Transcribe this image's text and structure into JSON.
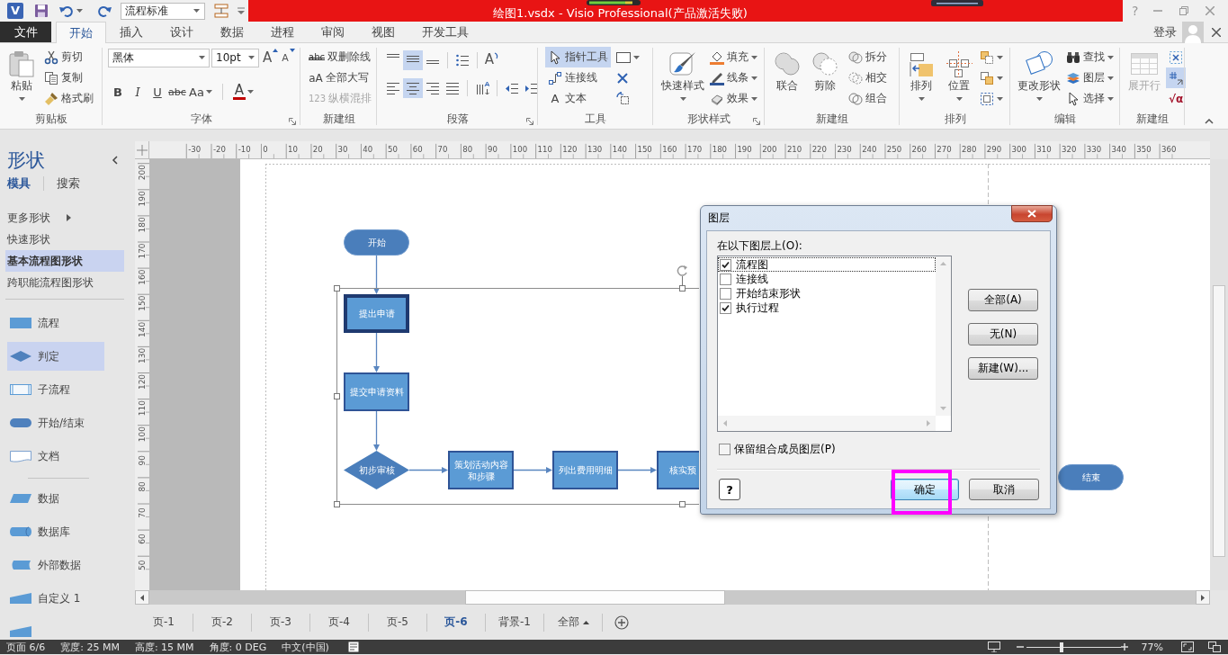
{
  "title_bar": {
    "logo": "V",
    "template": "流程标准",
    "title": "绘图1.vsdx - Visio Professional(产品激活失败)",
    "help": "?"
  },
  "tabs": [
    {
      "label": "文件",
      "kind": "backstage",
      "selected": false
    },
    {
      "label": "开始",
      "kind": "tab",
      "selected": true
    },
    {
      "label": "插入",
      "kind": "tab",
      "selected": false
    },
    {
      "label": "设计",
      "kind": "tab",
      "selected": false
    },
    {
      "label": "数据",
      "kind": "tab",
      "selected": false
    },
    {
      "label": "进程",
      "kind": "tab",
      "selected": false
    },
    {
      "label": "审阅",
      "kind": "tab",
      "selected": false
    },
    {
      "label": "视图",
      "kind": "tab",
      "selected": false
    },
    {
      "label": "开发工具",
      "kind": "tab",
      "selected": false
    }
  ],
  "account": {
    "sign_in": "登录"
  },
  "ribbon": {
    "clipboard": {
      "label": "剪贴板",
      "paste": "粘贴",
      "cut": "剪切",
      "copy": "复制",
      "format_painter": "格式刷"
    },
    "font": {
      "label": "字体",
      "launcher": true,
      "font_name": "黑体",
      "font_size": "10pt",
      "grow": "A",
      "shrink": "A",
      "styles": [
        {
          "glyph": "B",
          "kind": "bold"
        },
        {
          "glyph": "I",
          "kind": "italic"
        },
        {
          "glyph": "U",
          "kind": "underline"
        },
        {
          "glyph": "abc",
          "kind": "strikethrough"
        },
        {
          "glyph": "Aa",
          "kind": "case"
        }
      ],
      "font_color": {
        "glyph": "A",
        "color": "#c00000"
      }
    },
    "text": {
      "label": "新建组",
      "items": [
        {
          "glyph": "abc",
          "label": "双删除线",
          "kind": "double-strike",
          "disabled": false
        },
        {
          "glyph": "aA",
          "label": "全部大写",
          "kind": "caps",
          "disabled": false
        },
        {
          "glyph": "123",
          "label": "纵横混排",
          "kind": "horizontal-in-vertical",
          "disabled": true
        }
      ]
    },
    "paragraph": {
      "label": "段落",
      "launcher": true,
      "vertical_align": [
        {
          "selected": false
        },
        {
          "selected": true
        },
        {
          "selected": false
        }
      ],
      "horizontal_align": [
        {
          "selected": false
        },
        {
          "selected": true
        },
        {
          "selected": false
        },
        {
          "selected": false
        }
      ],
      "rotate_glyph": "A"
    },
    "tools": {
      "label": "工具",
      "items": [
        {
          "label": "指针工具",
          "kind": "pointer",
          "selected": true
        },
        {
          "label": "连接线",
          "kind": "connector",
          "selected": false
        },
        {
          "label": "文本",
          "kind": "text",
          "glyph": "A",
          "selected": false
        }
      ]
    },
    "shape_styles": {
      "label": "形状样式",
      "launcher": true,
      "quick_styles": "快速样式",
      "items": [
        {
          "label": "填充",
          "kind": "fill"
        },
        {
          "label": "线条",
          "kind": "line"
        },
        {
          "label": "效果",
          "kind": "effects"
        }
      ]
    },
    "operations": {
      "label": "新建组",
      "large": [
        {
          "label": "联合",
          "kind": "union"
        },
        {
          "label": "剪除",
          "kind": "subtract"
        }
      ],
      "small": [
        {
          "label": "拆分",
          "kind": "fragment"
        },
        {
          "label": "相交",
          "kind": "intersect"
        },
        {
          "label": "组合",
          "kind": "combine"
        }
      ]
    },
    "arrange": {
      "label": "排列",
      "large": [
        {
          "label": "排列",
          "kind": "arrange"
        },
        {
          "label": "位置",
          "kind": "position"
        }
      ]
    },
    "editing": {
      "label": "编辑",
      "change_shape": "更改形状",
      "items": [
        {
          "label": "查找",
          "kind": "find"
        },
        {
          "label": "图层",
          "kind": "layers"
        },
        {
          "label": "选择",
          "kind": "select"
        }
      ]
    },
    "custom": {
      "label": "新建组",
      "expand": {
        "label": "展开行",
        "disabled": true
      },
      "small": [
        {
          "kind": "snap",
          "selected": false
        },
        {
          "kind": "glue",
          "selected": true
        },
        {
          "kind": "equation",
          "glyph": "√α",
          "selected": false
        }
      ]
    }
  },
  "shapes_panel": {
    "title": "形状",
    "tabs": [
      {
        "label": "模具",
        "selected": true
      },
      {
        "label": "搜索",
        "selected": false
      }
    ],
    "stencils": [
      {
        "label": "更多形状",
        "kind": "submenu",
        "selected": false
      },
      {
        "label": "快速形状",
        "kind": "item",
        "selected": false
      },
      {
        "label": "基本流程图形状",
        "kind": "item",
        "selected": true
      },
      {
        "label": "跨职能流程图形状",
        "kind": "item",
        "selected": false
      }
    ],
    "sections": [
      {
        "masters": [
          {
            "label": "流程",
            "kind": "process",
            "selected": false
          },
          {
            "label": "判定",
            "kind": "decision",
            "selected": true
          },
          {
            "label": "子流程",
            "kind": "subprocess",
            "selected": false
          },
          {
            "label": "开始/结束",
            "kind": "terminator",
            "selected": false
          },
          {
            "label": "文档",
            "kind": "document",
            "selected": false
          }
        ]
      },
      {
        "masters": [
          {
            "label": "数据",
            "kind": "data",
            "selected": false
          },
          {
            "label": "数据库",
            "kind": "database",
            "selected": false
          },
          {
            "label": "外部数据",
            "kind": "external-data",
            "selected": false
          },
          {
            "label": "自定义 1",
            "kind": "custom",
            "selected": false
          },
          {
            "kind": "custom",
            "selected": false
          }
        ]
      }
    ]
  },
  "ruler": {
    "horizontal": [
      "-30",
      "-20",
      "-10",
      "0",
      "10",
      "20",
      "30",
      "40",
      "50",
      "60",
      "70",
      "80",
      "90",
      "100",
      "110",
      "120",
      "130",
      "140",
      "150",
      "160",
      "170",
      "180",
      "190",
      "200",
      "210",
      "220",
      "230",
      "240",
      "250",
      "260",
      "270",
      "280",
      "290",
      "300",
      "310",
      "320",
      "330",
      "340",
      "350",
      "360"
    ],
    "vertical": [
      "200",
      "190",
      "180",
      "170",
      "160",
      "150",
      "140",
      "130",
      "120",
      "110",
      "100",
      "90",
      "80",
      "70",
      "60",
      "50"
    ]
  },
  "diagram": {
    "nodes": [
      {
        "kind": "terminator",
        "label": "开始",
        "selected": false
      },
      {
        "kind": "process",
        "label": "提出申请",
        "selected": true
      },
      {
        "kind": "process",
        "label": "提交申请资料",
        "selected": false
      },
      {
        "kind": "decision",
        "label": "初步审核",
        "selected": false
      },
      {
        "kind": "process",
        "label": "策划活动内容和步骤",
        "selected": false
      },
      {
        "kind": "process",
        "label": "列出费用明细",
        "selected": false
      },
      {
        "kind": "process",
        "label": "核实预",
        "selected": false
      },
      {
        "kind": "terminator",
        "label": "结束",
        "selected": false
      }
    ]
  },
  "dialog": {
    "title": "图层",
    "prompt": "在以下图层上(O):",
    "layers": [
      {
        "label": "流程图",
        "checked": true,
        "focused": true
      },
      {
        "label": "连接线",
        "checked": false,
        "focused": false
      },
      {
        "label": "开始结束形状",
        "checked": false,
        "focused": false
      },
      {
        "label": "执行过程",
        "checked": true,
        "focused": false
      }
    ],
    "side_buttons": [
      "全部(A)",
      "无(N)",
      "新建(W)..."
    ],
    "preserve": {
      "label": "保留组合成员图层(P)",
      "checked": false
    },
    "help": "?",
    "ok": "确定",
    "cancel": "取消",
    "ok_highlighted": true
  },
  "page_tabs": [
    {
      "label": "页-1",
      "kind": "page",
      "selected": false
    },
    {
      "label": "页-2",
      "kind": "page",
      "selected": false
    },
    {
      "label": "页-3",
      "kind": "page",
      "selected": false
    },
    {
      "label": "页-4",
      "kind": "page",
      "selected": false
    },
    {
      "label": "页-5",
      "kind": "page",
      "selected": false
    },
    {
      "label": "页-6",
      "kind": "page",
      "selected": true
    },
    {
      "label": "背景-1",
      "kind": "page",
      "selected": false
    },
    {
      "label": "全部",
      "kind": "all",
      "selected": false
    }
  ],
  "status_bar": {
    "items": [
      "页面 6/6",
      "宽度: 25 MM",
      "高度: 15 MM",
      "角度: 0 DEG",
      "中文(中国)"
    ],
    "zoom": {
      "level": 0.38,
      "reading": "77%"
    }
  }
}
